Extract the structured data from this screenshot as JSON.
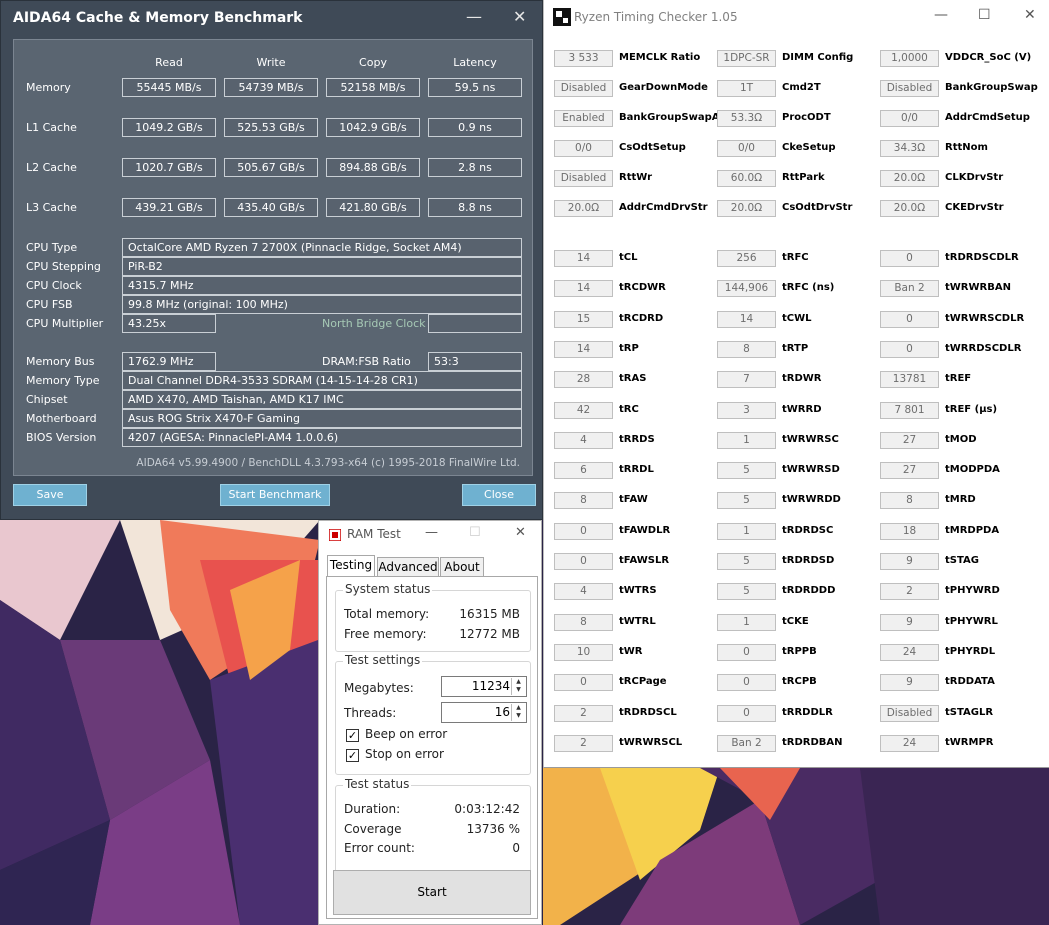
{
  "aida": {
    "title": "AIDA64 Cache & Memory Benchmark",
    "columns": [
      "Read",
      "Write",
      "Copy",
      "Latency"
    ],
    "rows": [
      {
        "label": "Memory",
        "values": [
          "55445 MB/s",
          "54739 MB/s",
          "52158 MB/s",
          "59.5 ns"
        ]
      },
      {
        "label": "L1 Cache",
        "values": [
          "1049.2 GB/s",
          "525.53 GB/s",
          "1042.9 GB/s",
          "0.9 ns"
        ]
      },
      {
        "label": "L2 Cache",
        "values": [
          "1020.7 GB/s",
          "505.67 GB/s",
          "894.88 GB/s",
          "2.8 ns"
        ]
      },
      {
        "label": "L3 Cache",
        "values": [
          "439.21 GB/s",
          "435.40 GB/s",
          "421.80 GB/s",
          "8.8 ns"
        ]
      }
    ],
    "cpu_info": [
      {
        "label": "CPU Type",
        "value": "OctalCore AMD Ryzen 7 2700X  (Pinnacle Ridge, Socket AM4)"
      },
      {
        "label": "CPU Stepping",
        "value": "PiR-B2"
      },
      {
        "label": "CPU Clock",
        "value": "4315.7 MHz"
      },
      {
        "label": "CPU FSB",
        "value": "99.8 MHz  (original: 100 MHz)"
      },
      {
        "label": "CPU Multiplier",
        "value": "43.25x"
      }
    ],
    "north_bridge_label": "North Bridge Clock",
    "north_bridge_value": "",
    "mem_info": [
      {
        "label": "Memory Bus",
        "value": "1762.9 MHz"
      },
      {
        "label": "Memory Type",
        "value": "Dual Channel DDR4-3533 SDRAM  (14-15-14-28 CR1)"
      },
      {
        "label": "Chipset",
        "value": "AMD X470, AMD Taishan, AMD K17 IMC"
      },
      {
        "label": "Motherboard",
        "value": "Asus ROG Strix X470-F Gaming"
      },
      {
        "label": "BIOS Version",
        "value": "4207  (AGESA: PinnaclePI-AM4 1.0.0.6)"
      }
    ],
    "dram_fsb_label": "DRAM:FSB Ratio",
    "dram_fsb_value": "53:3",
    "footer": "AIDA64 v5.99.4900 / BenchDLL 4.3.793-x64  (c) 1995-2018 FinalWire Ltd.",
    "buttons": {
      "save": "Save",
      "start": "Start Benchmark",
      "close": "Close"
    },
    "colors": {
      "bg": "#3f4a57",
      "panel": "#5a6571",
      "button": "#6fb1d0"
    }
  },
  "rtc": {
    "title": "Ryzen Timing Checker 1.05",
    "config_rows": [
      [
        {
          "value": "3 533",
          "label": "MEMCLK Ratio"
        },
        {
          "value": "1DPC-SR",
          "label": "DIMM Config"
        },
        {
          "value": "1,0000",
          "label": "VDDCR_SoC (V)"
        }
      ],
      [
        {
          "value": "Disabled",
          "label": "GearDownMode"
        },
        {
          "value": "1T",
          "label": "Cmd2T"
        },
        {
          "value": "Disabled",
          "label": "BankGroupSwap"
        }
      ],
      [
        {
          "value": "Enabled",
          "label": "BankGroupSwapAlt"
        },
        {
          "value": "53.3Ω",
          "label": "ProcODT"
        },
        {
          "value": "0/0",
          "label": "AddrCmdSetup"
        }
      ],
      [
        {
          "value": "0/0",
          "label": "CsOdtSetup"
        },
        {
          "value": "0/0",
          "label": "CkeSetup"
        },
        {
          "value": "34.3Ω",
          "label": "RttNom"
        }
      ],
      [
        {
          "value": "Disabled",
          "label": "RttWr"
        },
        {
          "value": "60.0Ω",
          "label": "RttPark"
        },
        {
          "value": "20.0Ω",
          "label": "CLKDrvStr"
        }
      ],
      [
        {
          "value": "20.0Ω",
          "label": "AddrCmdDrvStr"
        },
        {
          "value": "20.0Ω",
          "label": "CsOdtDrvStr"
        },
        {
          "value": "20.0Ω",
          "label": "CKEDrvStr"
        }
      ]
    ],
    "timing_rows": [
      [
        {
          "value": "14",
          "label": "tCL"
        },
        {
          "value": "256",
          "label": "tRFC"
        },
        {
          "value": "0",
          "label": "tRDRDSCDLR"
        }
      ],
      [
        {
          "value": "14",
          "label": "tRCDWR"
        },
        {
          "value": "144,906",
          "label": "tRFC (ns)"
        },
        {
          "value": "Ban 2",
          "label": "tWRWRBAN"
        }
      ],
      [
        {
          "value": "15",
          "label": "tRCDRD"
        },
        {
          "value": "14",
          "label": "tCWL"
        },
        {
          "value": "0",
          "label": "tWRWRSCDLR"
        }
      ],
      [
        {
          "value": "14",
          "label": "tRP"
        },
        {
          "value": "8",
          "label": "tRTP"
        },
        {
          "value": "0",
          "label": "tWRRDSCDLR"
        }
      ],
      [
        {
          "value": "28",
          "label": "tRAS"
        },
        {
          "value": "7",
          "label": "tRDWR"
        },
        {
          "value": "13781",
          "label": "tREF"
        }
      ],
      [
        {
          "value": "42",
          "label": "tRC"
        },
        {
          "value": "3",
          "label": "tWRRD"
        },
        {
          "value": "7 801",
          "label": "tREF (µs)"
        }
      ],
      [
        {
          "value": "4",
          "label": "tRRDS"
        },
        {
          "value": "1",
          "label": "tWRWRSC"
        },
        {
          "value": "27",
          "label": "tMOD"
        }
      ],
      [
        {
          "value": "6",
          "label": "tRRDL"
        },
        {
          "value": "5",
          "label": "tWRWRSD"
        },
        {
          "value": "27",
          "label": "tMODPDA"
        }
      ],
      [
        {
          "value": "8",
          "label": "tFAW"
        },
        {
          "value": "5",
          "label": "tWRWRDD"
        },
        {
          "value": "8",
          "label": "tMRD"
        }
      ],
      [
        {
          "value": "0",
          "label": "tFAWDLR"
        },
        {
          "value": "1",
          "label": "tRDRDSC"
        },
        {
          "value": "18",
          "label": "tMRDPDA"
        }
      ],
      [
        {
          "value": "0",
          "label": "tFAWSLR"
        },
        {
          "value": "5",
          "label": "tRDRDSD"
        },
        {
          "value": "9",
          "label": "tSTAG"
        }
      ],
      [
        {
          "value": "4",
          "label": "tWTRS"
        },
        {
          "value": "5",
          "label": "tRDRDDD"
        },
        {
          "value": "2",
          "label": "tPHYWRD"
        }
      ],
      [
        {
          "value": "8",
          "label": "tWTRL"
        },
        {
          "value": "1",
          "label": "tCKE"
        },
        {
          "value": "9",
          "label": "tPHYWRL"
        }
      ],
      [
        {
          "value": "10",
          "label": "tWR"
        },
        {
          "value": "0",
          "label": "tRPPB"
        },
        {
          "value": "24",
          "label": "tPHYRDL"
        }
      ],
      [
        {
          "value": "0",
          "label": "tRCPage"
        },
        {
          "value": "0",
          "label": "tRCPB"
        },
        {
          "value": "9",
          "label": "tRDDATA"
        }
      ],
      [
        {
          "value": "2",
          "label": "tRDRDSCL"
        },
        {
          "value": "0",
          "label": "tRRDDLR"
        },
        {
          "value": "Disabled",
          "label": "tSTAGLR"
        }
      ],
      [
        {
          "value": "2",
          "label": "tWRWRSCL"
        },
        {
          "value": "Ban 2",
          "label": "tRDRDBAN"
        },
        {
          "value": "24",
          "label": "tWRMPR"
        }
      ]
    ]
  },
  "ramtest": {
    "title": "RAM Test",
    "tabs": [
      "Testing",
      "Advanced",
      "About"
    ],
    "system_status": {
      "title": "System status",
      "total_label": "Total memory:",
      "total_value": "16315 MB",
      "free_label": "Free memory:",
      "free_value": "12772 MB"
    },
    "test_settings": {
      "title": "Test settings",
      "megabytes_label": "Megabytes:",
      "megabytes_value": "11234",
      "threads_label": "Threads:",
      "threads_value": "16",
      "beep_label": "Beep on error",
      "beep_checked": true,
      "stop_label": "Stop on error",
      "stop_checked": true
    },
    "test_status": {
      "title": "Test status",
      "duration_label": "Duration:",
      "duration_value": "0:03:12:42",
      "coverage_label": "Coverage",
      "coverage_value": "13736 %",
      "errors_label": "Error count:",
      "errors_value": "0"
    },
    "start_label": "Start"
  }
}
